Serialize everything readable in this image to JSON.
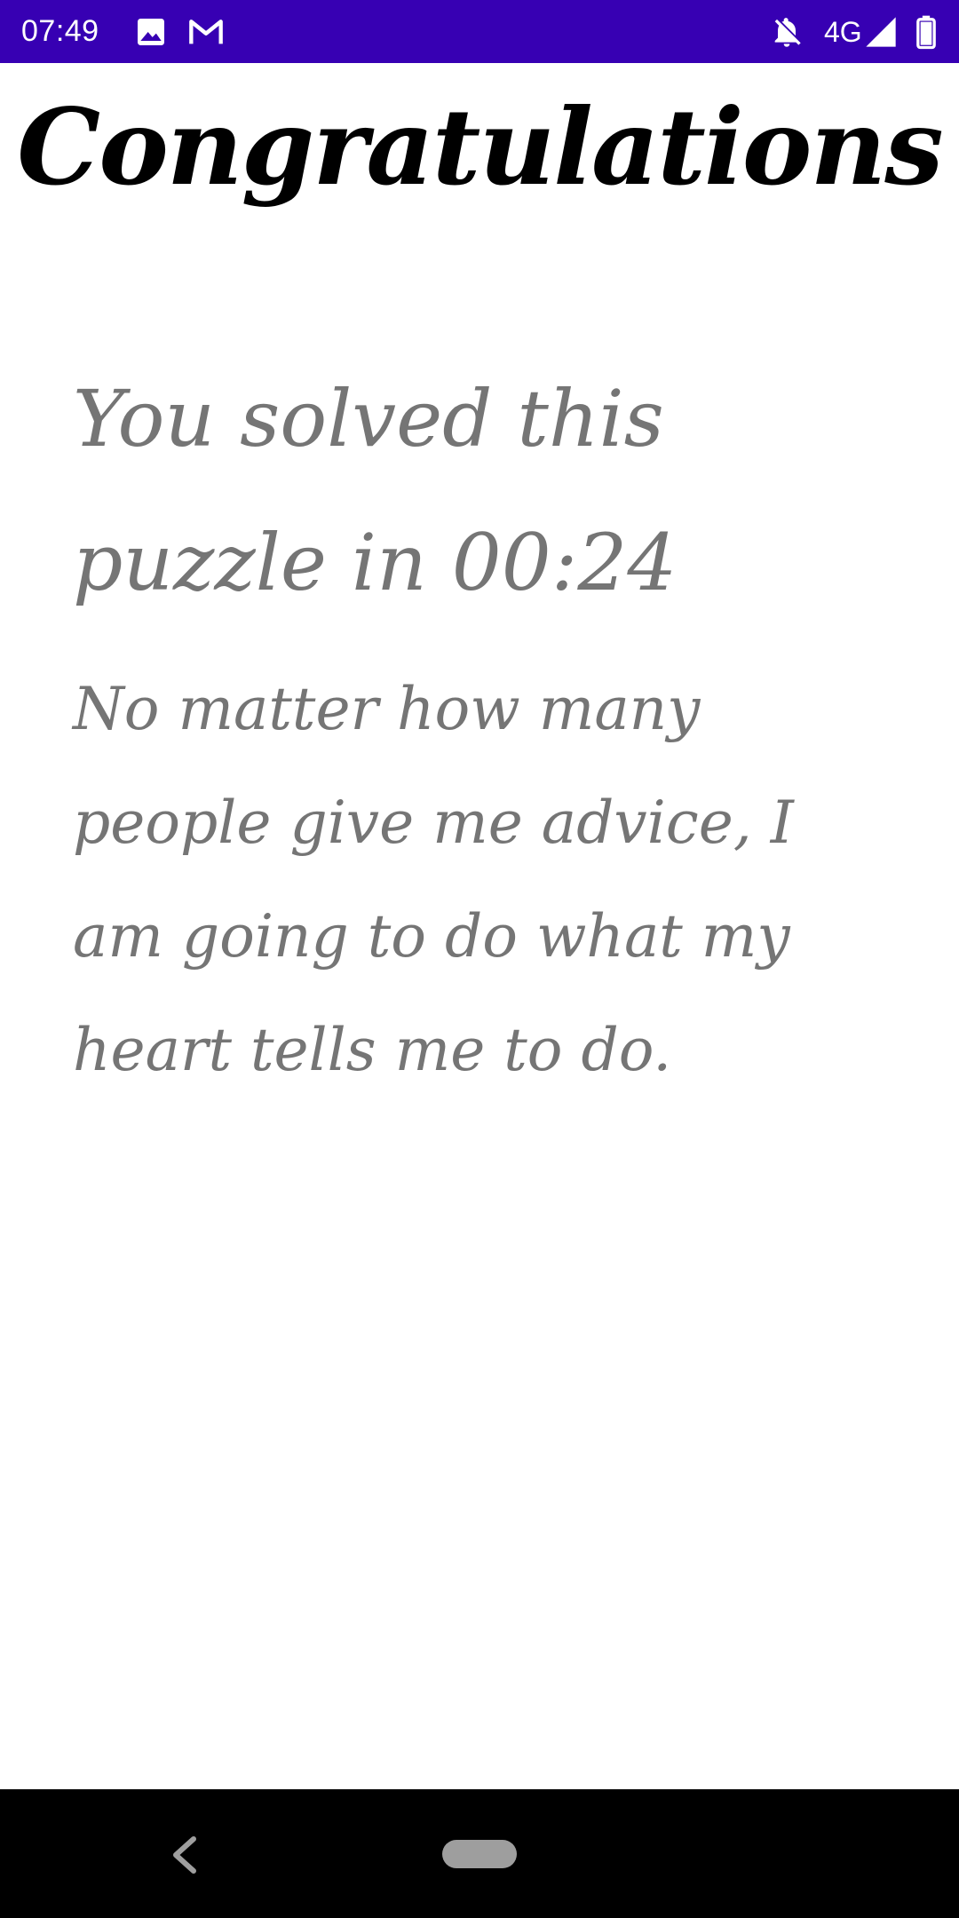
{
  "status_bar": {
    "time": "07:49",
    "network": "4G",
    "background_color": "#3700b3",
    "icons": [
      "image-icon",
      "gmail-icon",
      "notifications-off-icon",
      "signal-icon",
      "battery-icon"
    ]
  },
  "main": {
    "title": "Congratulations",
    "solved_message": "You solved this puzzle in 00:24",
    "quote": "No matter how many people give me advice, I am going to do what my heart tells me to do.",
    "title_color": "#000000",
    "text_color": "#757575"
  },
  "nav_bar": {
    "icons": [
      "back-icon",
      "home-pill"
    ],
    "background_color": "#000000"
  }
}
